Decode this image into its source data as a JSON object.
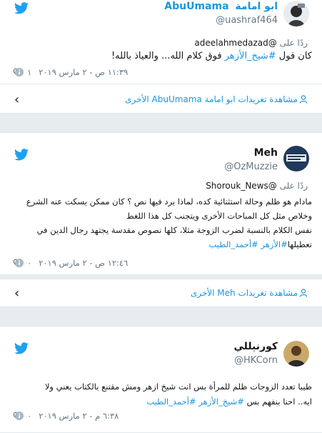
{
  "tweets": [
    {
      "display_name": "ابو امامة",
      "username": "AbuUmama",
      "handle": "@uashraf464",
      "reply_prefix": "ردًا على",
      "reply_to": "@adeelahmedazad",
      "text_parts": [
        "كان قول ",
        "#شيخ_الأزهر",
        " فوق كلام الله... والعياذ بالله!"
      ],
      "time": "١١:٣٩ ص - ٢ مارس ٢٠١٩",
      "likes": "١",
      "more_label": "مشاهدة تغريدات ابو امامة AbuUmama الأخرى"
    },
    {
      "display_name": "Meh",
      "handle": "@OzMuzzie",
      "reply_prefix": "ردًا على",
      "reply_to": "@Shorouk_News",
      "line1": "مادام هو ظلم وحالة استثنائية كده، لماذا يرد فيها نص ؟ كان ممكن يسكت عنه الشرع",
      "line2": "وخلاص مثل كل المباحات الأخرى ويتجنب كل هذا اللغط",
      "line3": "نفس الكلام بالنسبة لضرب الزوجة مثلا، كلها نصوص مقدسة يجتهد رجال الدين في",
      "line4_prefix": "تعطيلها",
      "hashtag1": "#الأزهر",
      "hashtag2": "#أحمد_الطيب",
      "time": "١٢:٤٦ ص - ٢ مارس ٢٠١٩",
      "likes": "٠",
      "more_label": "مشاهدة تغريدات Meh الأخرى"
    },
    {
      "display_name": "كورنيللي",
      "handle": "@HKCorn",
      "line1": "طيبا تعدد الزوجات ظلم للمرأة بس انت شيخ ازهر ومش مقتنع بالكتاب يعني ولا",
      "line2_prefix": "ايه.. احنا بنفهم بس ",
      "hashtag1": "#شيخ_الأزهر",
      "hashtag2": "#أحمد_الطيب",
      "time": "٦:٣٨ م - ٢ مارس ٢٠١٩",
      "likes": "٠"
    }
  ],
  "colors": {
    "twitter_blue": "#1da1f2",
    "link": "#1b95e0",
    "muted": "#657786",
    "background": "#e6ecf0"
  },
  "icons": [
    "twitter-bird-icon",
    "heart-icon",
    "info-icon",
    "chevron-left-icon",
    "person-icon"
  ]
}
